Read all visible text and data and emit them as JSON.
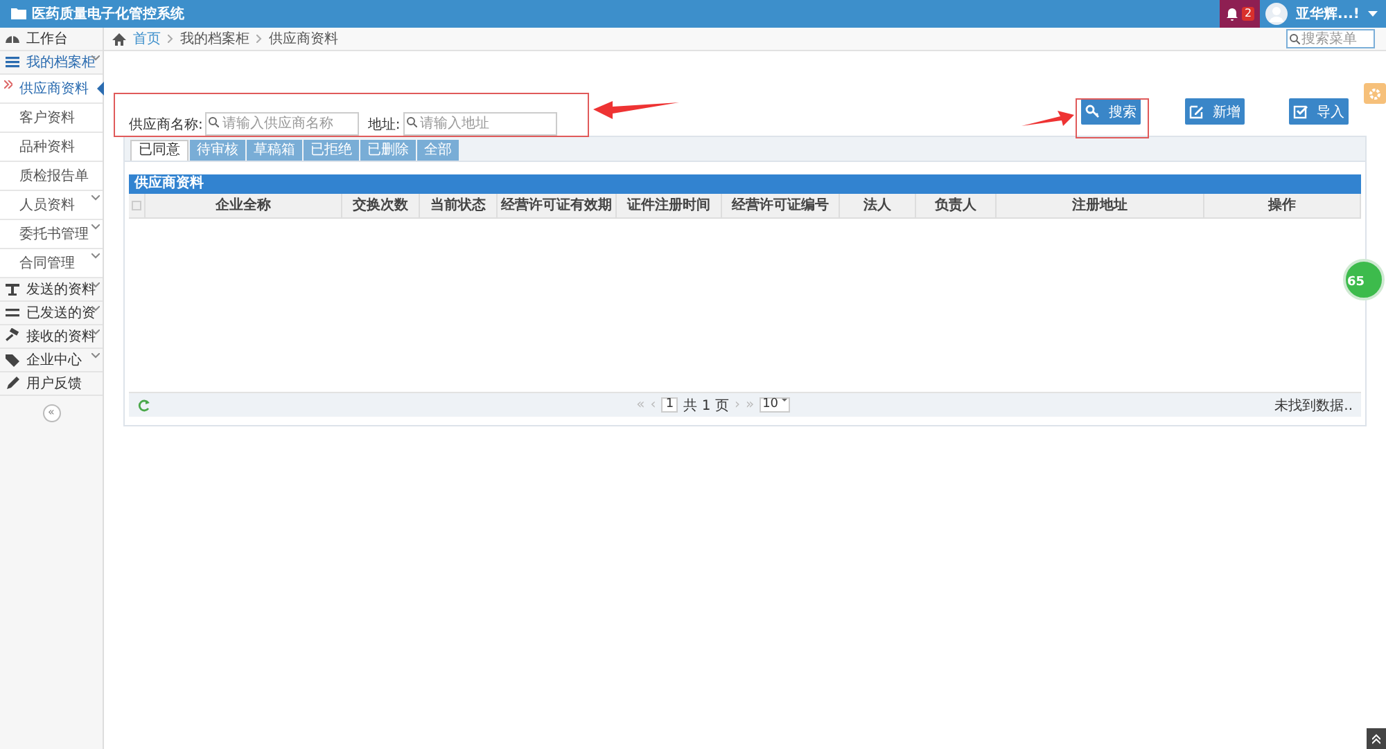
{
  "header": {
    "title": "医药质量电子化管控系统",
    "notification_count": "2",
    "user_name": "亚华辉...!"
  },
  "breadcrumb": [
    "首页",
    "我的档案柜",
    "供应商资料"
  ],
  "menu_search": {
    "placeholder": "搜索菜单"
  },
  "sidebar": {
    "items": [
      {
        "label": "工作台",
        "expanded": false,
        "expandable": false
      },
      {
        "label": "我的档案柜",
        "expanded": true,
        "expandable": true,
        "children": [
          {
            "label": "供应商资料",
            "selected": true,
            "expandable": false
          },
          {
            "label": "客户资料",
            "selected": false,
            "expandable": false
          },
          {
            "label": "品种资料",
            "selected": false,
            "expandable": false
          },
          {
            "label": "质检报告单",
            "selected": false,
            "expandable": false
          },
          {
            "label": "人员资料",
            "selected": false,
            "expandable": true
          },
          {
            "label": "委托书管理",
            "selected": false,
            "expandable": true
          },
          {
            "label": "合同管理",
            "selected": false,
            "expandable": true
          }
        ]
      },
      {
        "label": "发送的资料",
        "expanded": false,
        "expandable": true
      },
      {
        "label": "已发送的资",
        "expanded": false,
        "expandable": true
      },
      {
        "label": "接收的资料",
        "expanded": false,
        "expandable": true
      },
      {
        "label": "企业中心",
        "expanded": false,
        "expandable": true
      },
      {
        "label": "用户反馈",
        "expanded": false,
        "expandable": false
      }
    ],
    "collapse_label": "«"
  },
  "filters": [
    {
      "label": "供应商名称:",
      "placeholder": "请输入供应商名称"
    },
    {
      "label": "地址:",
      "placeholder": "请输入地址"
    }
  ],
  "buttons": [
    {
      "label": "搜索"
    },
    {
      "label": "新增"
    },
    {
      "label": "导入"
    }
  ],
  "tabs": [
    {
      "label": "已同意",
      "selected": true
    },
    {
      "label": "待审核",
      "selected": false
    },
    {
      "label": "草稿箱",
      "selected": false
    },
    {
      "label": "已拒绝",
      "selected": false
    },
    {
      "label": "已删除",
      "selected": false
    },
    {
      "label": "全部",
      "selected": false
    }
  ],
  "table": {
    "title": "供应商资料",
    "select_all_checked": false,
    "columns": [
      "企业全称",
      "交换次数",
      "当前状态",
      "经营许可证有效期",
      "证件注册时间",
      "经营许可证编号",
      "法人",
      "负责人",
      "注册地址",
      "操作"
    ]
  },
  "pager": {
    "first": "«",
    "prev": "‹",
    "page": "1",
    "total": "共 1 页",
    "next": "›",
    "last": "»",
    "page_size": "10",
    "status": "未找到数据.."
  },
  "side_badge": "65"
}
